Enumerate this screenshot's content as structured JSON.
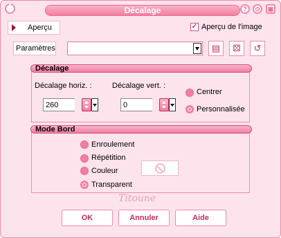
{
  "window": {
    "title": "Décalage"
  },
  "top": {
    "preview_label": "Aperçu",
    "preview_checkbox_label": "Aperçu de l'image",
    "preview_checked": true
  },
  "params": {
    "label": "Paramètres",
    "value": ""
  },
  "offset_group": {
    "title": "Décalage",
    "horiz_label": "Décalage horiz. :",
    "horiz_value": "260",
    "vert_label": "Décalage vert. :",
    "vert_value": "0",
    "center_label": "Centrer",
    "custom_label": "Personnalisée",
    "selected": "custom"
  },
  "edge_group": {
    "title": "Mode Bord",
    "options": [
      "Enroulement",
      "Répétition",
      "Couleur",
      "Transparent"
    ],
    "selected": "Transparent"
  },
  "watermark": "Titoune",
  "buttons": {
    "ok": "OK",
    "cancel": "Annuler",
    "help": "Aide"
  },
  "colors": {
    "accent": "#f27ea2",
    "background": "#fde3ec",
    "text_accent": "#c22c62"
  }
}
